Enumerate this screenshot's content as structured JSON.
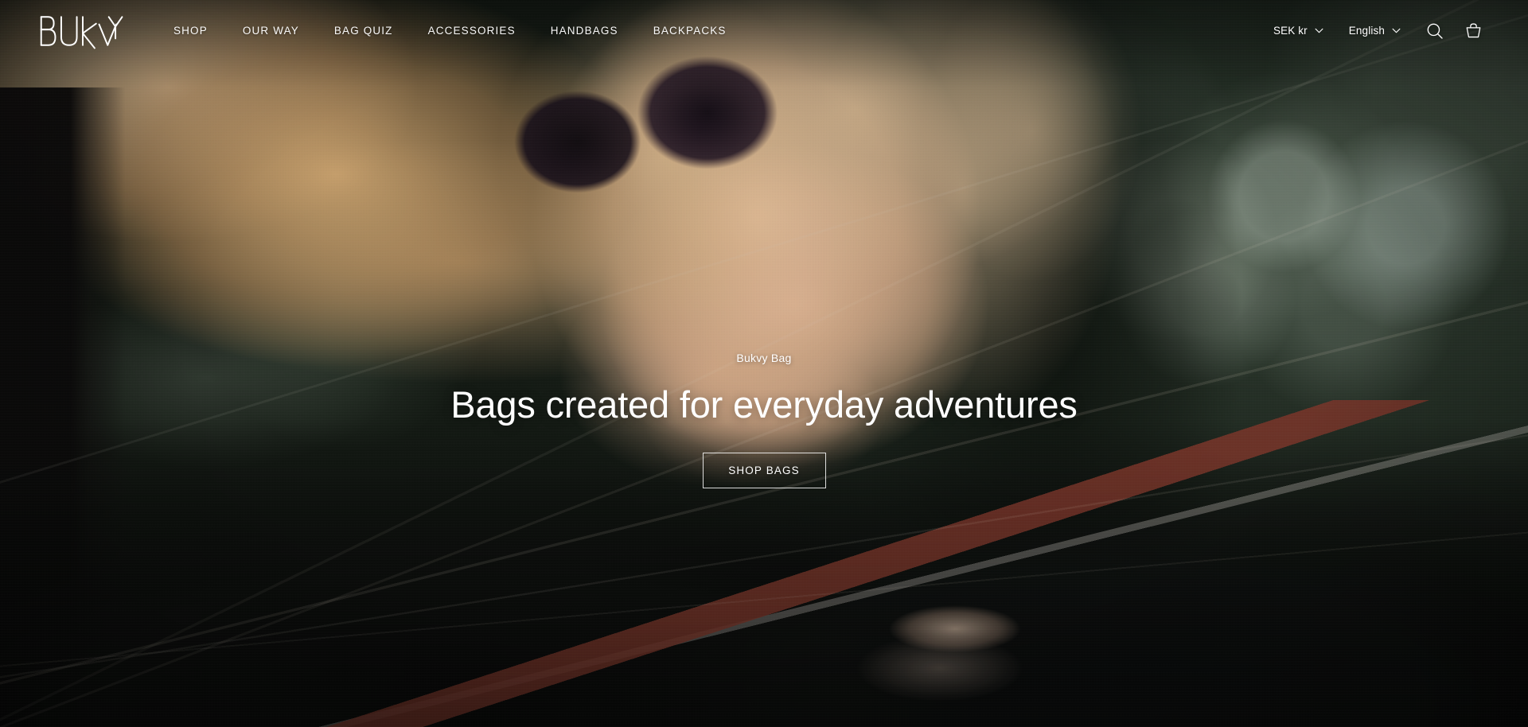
{
  "brand": {
    "logo_text": "BUKVY"
  },
  "header": {
    "nav": [
      {
        "label": "SHOP"
      },
      {
        "label": "OUR WAY"
      },
      {
        "label": "BAG QUIZ"
      },
      {
        "label": "ACCESSORIES"
      },
      {
        "label": "HANDBAGS"
      },
      {
        "label": "BACKPACKS"
      }
    ],
    "currency": {
      "label": "SEK kr",
      "icon": "chevron-down-icon"
    },
    "language": {
      "label": "English",
      "icon": "chevron-down-icon"
    },
    "search": {
      "icon": "search-icon",
      "label": "Search"
    },
    "cart": {
      "icon": "shopping-basket-icon",
      "label": "Cart"
    }
  },
  "hero": {
    "eyebrow": "Bukvy Bag",
    "title": "Bags created for everyday adventures",
    "cta_label": "SHOP BAGS"
  },
  "colors": {
    "text_on_hero": "#ffffff",
    "cta_border": "#ffffff",
    "bokeh_green": "#2d3a2e",
    "skin_warm": "#e2ba98",
    "hair_blonde": "#d0a670",
    "coat_dark": "#0a0b0a",
    "strap_brown": "#783428"
  }
}
